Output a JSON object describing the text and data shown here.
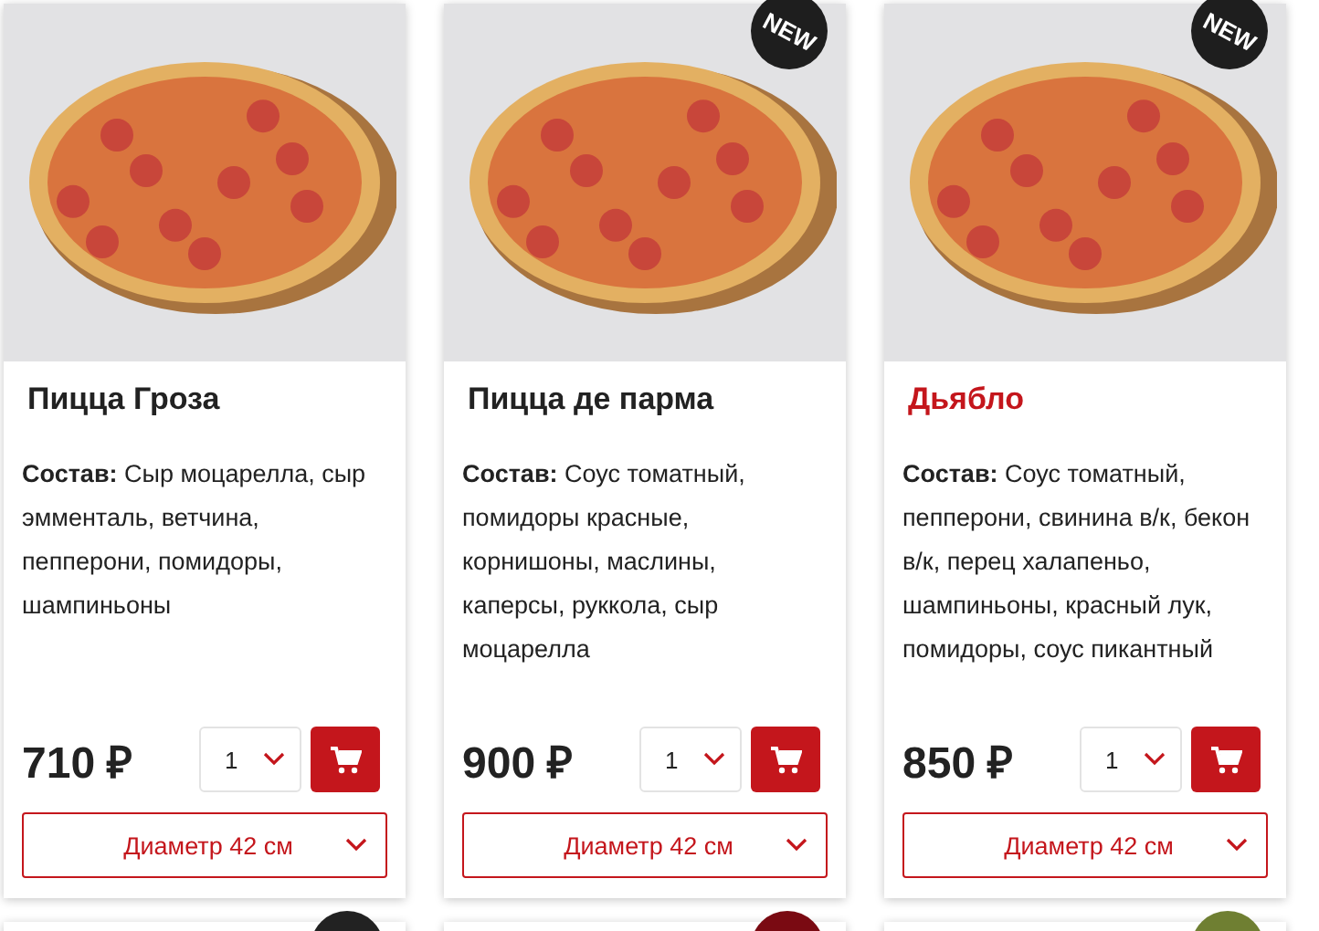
{
  "products": [
    {
      "title": "Пицца Гроза",
      "highlighted": false,
      "composition_label": "Состав:",
      "composition": "Сыр моцарелла, сыр эмменталь, ветчина, пепперони, помидоры, шампиньоны",
      "price": "710 ₽",
      "quantity": "1",
      "size": "Диаметр 42 см"
    },
    {
      "title": "Пицца де парма",
      "highlighted": false,
      "badge": "NEW",
      "composition_label": "Состав:",
      "composition": "Соус томатный, помидоры красные, корнишоны, маслины, каперсы, руккола, сыр моцарелла",
      "price": "900 ₽",
      "quantity": "1",
      "size": "Диаметр 42 см"
    },
    {
      "title": "Дьябло",
      "highlighted": true,
      "badge": "NEW",
      "composition_label": "Состав:",
      "composition": "Соус томатный, пепперони, свинина в/к, бекон в/к, перец халапеньо, шампиньоны, красный лук, помидоры, соус пикантный",
      "price": "850 ₽",
      "quantity": "1",
      "size": "Диаметр 42 см"
    }
  ],
  "next_row": [
    {
      "color": "#222222"
    },
    {
      "color": "#7a0a12"
    },
    {
      "color": "#6f7f32"
    }
  ]
}
